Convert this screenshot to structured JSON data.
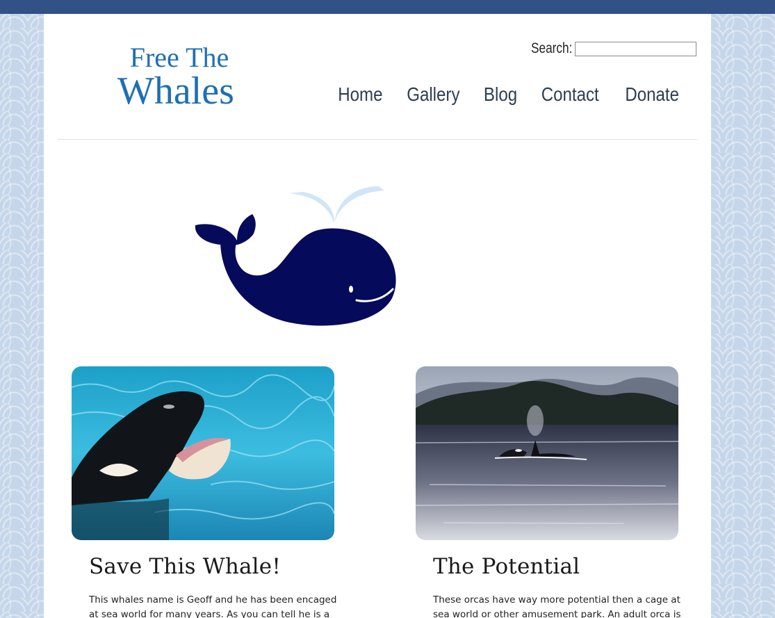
{
  "site": {
    "logo_line1": "Free The",
    "logo_line2": "Whales"
  },
  "search": {
    "label": "Search:",
    "value": ""
  },
  "nav": {
    "items": [
      "Home",
      "Gallery",
      "Blog",
      "Contact",
      "Donate"
    ]
  },
  "cards": [
    {
      "title": "Save This Whale!",
      "text": "This whales name is Geoff and he has been encaged at sea world for many years. As you can tell he is a whale"
    },
    {
      "title": "The Potential",
      "text": "These orcas have way more potential then a cage at sea world or other amusement park. An adult orca is"
    }
  ],
  "colors": {
    "topbar": "#315187",
    "logo": "#1f6fb2",
    "whale": "#060a5a",
    "spout": "#cfe6f7"
  }
}
